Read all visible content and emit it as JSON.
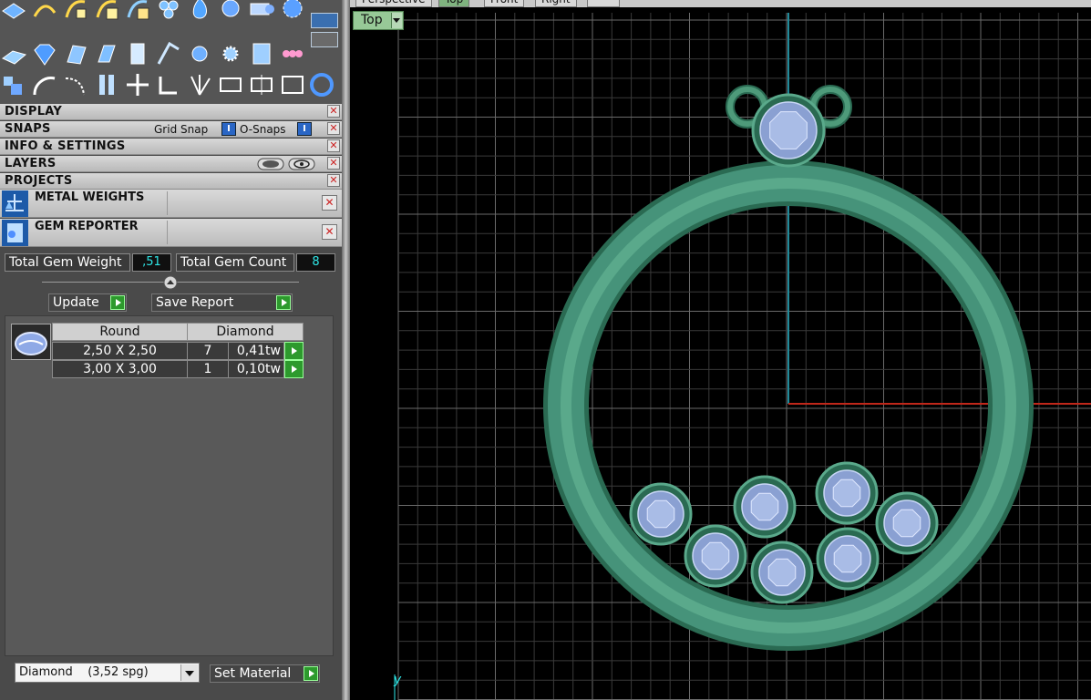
{
  "panels": {
    "display": "DISPLAY",
    "snaps": "SNAPS",
    "grid_snap": "Grid Snap",
    "o_snaps": "O-Snaps",
    "info_settings": "INFO & SETTINGS",
    "layers": "LAYERS",
    "projects": "PROJECTS",
    "close_glyph": "✕"
  },
  "metal_weights": {
    "title": "METAL WEIGHTS"
  },
  "gem_reporter": {
    "title": "GEM REPORTER",
    "total_weight_label": "Total Gem Weight",
    "total_weight_value": ",51",
    "total_count_label": "Total Gem Count",
    "total_count_value": "8",
    "update_label": "Update",
    "save_report_label": "Save Report",
    "table": {
      "headers": [
        "Round",
        "Diamond"
      ],
      "rows": [
        {
          "size": "2,50 X 2,50",
          "count": "7",
          "weight": "0,41tw"
        },
        {
          "size": "3,00 X 3,00",
          "count": "1",
          "weight": "0,10tw"
        }
      ]
    }
  },
  "material": {
    "selected": "Diamond    (3,52 spg)",
    "set_label": "Set Material"
  },
  "viewport": {
    "tabs": [
      "Perspective",
      "Top",
      "Front",
      "Right"
    ],
    "active_tab": "Top",
    "view_label": "Top",
    "axis_label": "y"
  },
  "colors": {
    "metal": "#3f8a6c",
    "metal_dark": "#2a6a52",
    "gem": "#8aa0d2",
    "grid": "#4a4a4a",
    "axis_y": "#1f8a9a",
    "axis_x": "#c0271a"
  }
}
